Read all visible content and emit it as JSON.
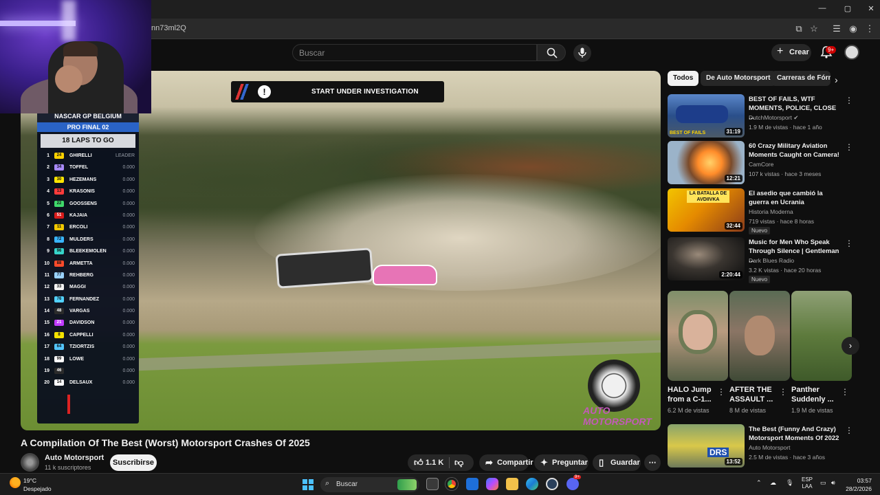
{
  "browser": {
    "url_partial": "nn73ml2Q",
    "window_controls": [
      "—",
      "▢",
      "✕"
    ]
  },
  "header": {
    "search_placeholder": "Buscar",
    "create_label": "Crear",
    "notifications_badge": "9+"
  },
  "player": {
    "banner_text": "START UNDER INVESTIGATION",
    "scoreboard": {
      "title": "NASCAR GP BELGIUM",
      "subtitle": "PRO FINAL 02",
      "laps": "18 LAPS TO GO",
      "leader_label": "LEADER",
      "rows": [
        {
          "pos": "1",
          "num": "24",
          "name": "GHIRELLI",
          "color": "#ffd200"
        },
        {
          "pos": "2",
          "num": "34",
          "name": "TOFFEL",
          "color": "#a98bff"
        },
        {
          "pos": "3",
          "num": "30",
          "name": "HEZEMANS",
          "color": "#ffe600"
        },
        {
          "pos": "4",
          "num": "13",
          "name": "KRASONIS",
          "color": "#ff3b3b"
        },
        {
          "pos": "5",
          "num": "22",
          "name": "GOOSSENS",
          "color": "#3fd96b"
        },
        {
          "pos": "6",
          "num": "51",
          "name": "KAJAIA",
          "color": "#d81b1b"
        },
        {
          "pos": "7",
          "num": "11",
          "name": "ERCOLI",
          "color": "#f2c800"
        },
        {
          "pos": "8",
          "num": "72",
          "name": "MULDERS",
          "color": "#39b6ff"
        },
        {
          "pos": "9",
          "num": "96",
          "name": "BLEEKEMOLEN",
          "color": "#36d4c9"
        },
        {
          "pos": "10",
          "num": "88",
          "name": "ARMETTA",
          "color": "#ff4b2b"
        },
        {
          "pos": "11",
          "num": "77",
          "name": "REHBERG",
          "color": "#9ad2ff"
        },
        {
          "pos": "12",
          "num": "33",
          "name": "MAGGI",
          "color": "#f4f4f4"
        },
        {
          "pos": "13",
          "num": "76",
          "name": "FERNANDEZ",
          "color": "#52d1ff"
        },
        {
          "pos": "14",
          "num": "48",
          "name": "VARGAS",
          "color": "#2b2b2b"
        },
        {
          "pos": "15",
          "num": "21",
          "name": "DAVIDSON",
          "color": "#c23bff"
        },
        {
          "pos": "16",
          "num": "8",
          "name": "CAPPELLI",
          "color": "#f5e300"
        },
        {
          "pos": "17",
          "num": "64",
          "name": "TZIORTZIS",
          "color": "#53c6ff"
        },
        {
          "pos": "18",
          "num": "99",
          "name": "LOWE",
          "color": "#ffffff"
        },
        {
          "pos": "19",
          "num": "46",
          "name": "",
          "color": "#2b2b2b"
        },
        {
          "pos": "20",
          "num": "14",
          "name": "DELSAUX",
          "color": "#ffffff"
        }
      ],
      "gap_value": "0.000"
    }
  },
  "video": {
    "title": "A Compilation Of The Best (Worst) Motorsport Crashes Of 2025",
    "channel": "Auto Motorsport",
    "subscribers": "11 k suscriptores",
    "subscribe_label": "Suscribirse",
    "likes": "1.1 K",
    "share_label": "Compartir",
    "ask_label": "Preguntar",
    "save_label": "Guardar"
  },
  "sidebar": {
    "chips": [
      "Todos",
      "De Auto Motorsport",
      "Carreras de Fórm"
    ],
    "videos": [
      {
        "title": "BEST OF FAILS, WTF MOMENTS, POLICE, CLOSE ...",
        "channel": "DutchMotorsport",
        "meta": "1.9 M de vistas · hace 1 año",
        "duration": "31:19",
        "thumb_caption": "BEST OF FAILS",
        "new": ""
      },
      {
        "title": "60 Crazy Military Aviation Moments Caught on Camera!",
        "channel": "CamCore",
        "meta": "107 k vistas · hace 3 meses",
        "duration": "12:21",
        "thumb_caption": "",
        "new": ""
      },
      {
        "title": "El asedio que cambió la guerra en Ucrania",
        "channel": "Historia Moderna",
        "meta": "719 vistas · hace 8 horas",
        "duration": "32:44",
        "thumb_caption": "LA BATALLA DE AVDIIVKA",
        "new": "Nuevo"
      },
      {
        "title": "Music for Men Who Speak Through Silence | Gentleman ...",
        "channel": "Dark Blues Radio",
        "meta": "3.2 K vistas · hace 20 horas",
        "duration": "2:20:44",
        "thumb_caption": "",
        "new": "Nuevo"
      }
    ],
    "shorts": [
      {
        "title": "HALO Jump from a C-1...",
        "views": "6.2 M de vistas"
      },
      {
        "title": "AFTER THE ASSAULT ...",
        "views": "8 M de vistas"
      },
      {
        "title": "Panther Suddenly ...",
        "views": "1.9 M de vistas"
      }
    ],
    "bottom_video": {
      "title": "The Best (Funny And Crazy) Motorsport Moments Of 2022",
      "channel": "Auto Motorsport",
      "meta": "2.5 M de vistas · hace 3 años",
      "duration": "13:52",
      "thumb_caption": "DRS"
    }
  },
  "taskbar": {
    "temperature": "19°C",
    "condition": "Despejado",
    "search_label": "Buscar",
    "language": "ESP",
    "layout": "LAA",
    "time": "03:57",
    "date": "28/2/2026",
    "discord_badge": "9+"
  }
}
